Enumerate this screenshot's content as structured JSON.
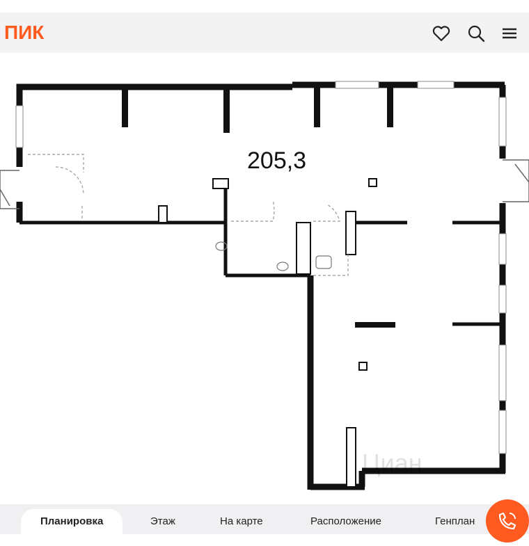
{
  "header": {
    "logo_text": "ПИК",
    "brand_color": "#ff5a1f",
    "icons": [
      "heart-icon",
      "search-icon",
      "menu-icon"
    ]
  },
  "plan": {
    "area": "205,3",
    "watermark": "Циан"
  },
  "tabs": [
    {
      "label": "Планировка",
      "active": true
    },
    {
      "label": "Этаж",
      "active": false
    },
    {
      "label": "На карте",
      "active": false
    },
    {
      "label": "Расположение",
      "active": false
    },
    {
      "label": "Генплан",
      "active": false
    }
  ],
  "call_button": {
    "icon": "phone-icon",
    "color": "#ff5a1f"
  }
}
